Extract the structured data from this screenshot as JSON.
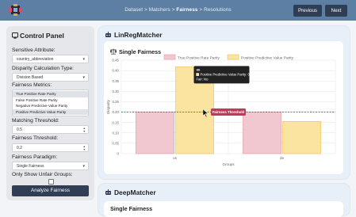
{
  "colors": {
    "topbar": "#5d7fa3",
    "button": "#2f3e55",
    "tpr": "#f1c8cf",
    "ppv": "#fbe3a0",
    "threshold": "#c0395a"
  },
  "nav": {
    "breadcrumb": [
      {
        "label": "Dataset",
        "current": false
      },
      {
        "label": "Matchers",
        "current": false
      },
      {
        "label": "Fairness",
        "current": true
      },
      {
        "label": "Resolutions",
        "current": false
      }
    ],
    "separator": ">",
    "previous_label": "Previous",
    "next_label": "Next"
  },
  "control_panel": {
    "title": "Control Panel",
    "sensitive_attribute": {
      "label": "Sensitive Attribute:",
      "value": "country_abbreviation"
    },
    "disparity": {
      "label": "Disparity Calculation Type:",
      "value": "Division Based"
    },
    "metrics": {
      "label": "Fairness Metrics:",
      "options": [
        "True Positive Rate Parity",
        "False Positive Rate Parity",
        "Negative Predictive Value Parity",
        "Positive Predictive Value Parity"
      ],
      "selected": [
        0,
        3
      ]
    },
    "matching_threshold": {
      "label": "Matching Threshold:",
      "value": "0.5"
    },
    "fairness_threshold": {
      "label": "Fairness Threshold:",
      "value": "0.2"
    },
    "paradigm": {
      "label": "Fairness Paradigm:",
      "value": "Single Fairness"
    },
    "unfair_only": {
      "label": "Only Show Unfair Groups:",
      "checked": false
    },
    "analyze_label": "Analyze Fairness"
  },
  "lin_reg": {
    "title": "LinRegMatcher",
    "section_title": "Single Fairness"
  },
  "deep": {
    "title": "DeepMatcher",
    "section_title": "Single Fairness"
  },
  "chart_data": {
    "type": "bar",
    "categories": [
      "us",
      "de"
    ],
    "series": [
      {
        "name": "True Positive Rate Parity",
        "values": [
          0.2,
          0.2
        ],
        "color": "#f1c8cf",
        "stroke": "#e79aa8"
      },
      {
        "name": "Positive Predictive Value Parity",
        "values": [
          0.418,
          0.155
        ],
        "color": "#fbe3a0",
        "stroke": "#edc55a"
      }
    ],
    "xlabel": "Groups",
    "ylabel": "Disparity",
    "ylim": [
      0,
      0.45
    ],
    "yticks": [
      0,
      0.05,
      0.1,
      0.15,
      0.2,
      0.25,
      0.3,
      0.35,
      0.4,
      0.45
    ],
    "ytick_labels": [
      "0",
      "0.05",
      "0.10",
      "0.15",
      "0.20",
      "0.25",
      "0.30",
      "0.35",
      "0.40",
      "0.45"
    ],
    "threshold": {
      "value": 0.2,
      "label": "Fairness Threshold"
    },
    "tooltip": {
      "title": "us",
      "line1": "Positive Predictive Value Parity: 0.418",
      "line2": "Fair: No"
    },
    "legend": "top"
  }
}
